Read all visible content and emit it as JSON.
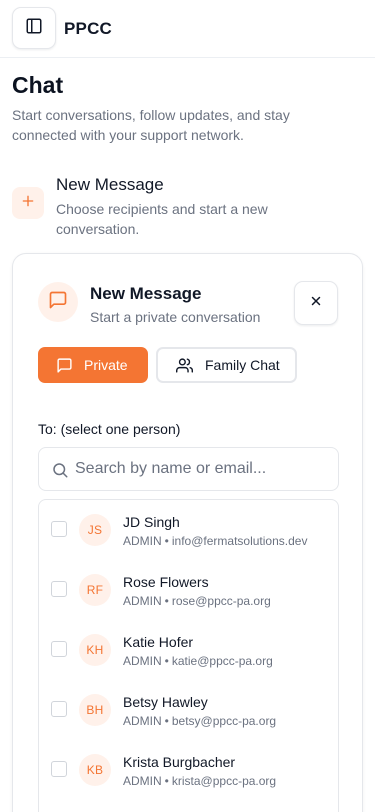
{
  "app": {
    "title": "PPCC"
  },
  "page": {
    "title": "Chat",
    "subtitle": "Start conversations, follow updates, and stay connected with your support network."
  },
  "new_message": {
    "title": "New Message",
    "description": "Choose recipients and start a new conversation."
  },
  "composer": {
    "title": "New Message",
    "subtitle": "Start a private conversation",
    "tabs": [
      {
        "label": "Private",
        "active": true
      },
      {
        "label": "Family Chat",
        "active": false
      }
    ],
    "to_label": "To: (select one person)",
    "search": {
      "placeholder": "Search by name or email...",
      "value": ""
    },
    "recipients": [
      {
        "initials": "JS",
        "name": "JD Singh",
        "role": "ADMIN",
        "email": "info@fermatsolutions.dev",
        "checked": false
      },
      {
        "initials": "RF",
        "name": "Rose Flowers",
        "role": "ADMIN",
        "email": "rose@ppcc-pa.org",
        "checked": false
      },
      {
        "initials": "KH",
        "name": "Katie Hofer",
        "role": "ADMIN",
        "email": "katie@ppcc-pa.org",
        "checked": false
      },
      {
        "initials": "BH",
        "name": "Betsy Hawley",
        "role": "ADMIN",
        "email": "betsy@ppcc-pa.org",
        "checked": false
      },
      {
        "initials": "KB",
        "name": "Krista Burgbacher",
        "role": "ADMIN",
        "email": "krista@ppcc-pa.org",
        "checked": false
      }
    ]
  },
  "icons": {
    "sidebar_toggle": "sidebar-toggle-icon",
    "new_message": "plus-icon",
    "composer": "message-square-icon",
    "close": "close-icon",
    "private_tab": "message-square-icon",
    "family_tab": "users-icon",
    "search": "search-icon"
  },
  "colors": {
    "accent": "#f47533",
    "accent_soft": "#fff1ea",
    "muted_text": "#6b7280",
    "border": "#e5e7eb"
  },
  "meta_separator": "•"
}
